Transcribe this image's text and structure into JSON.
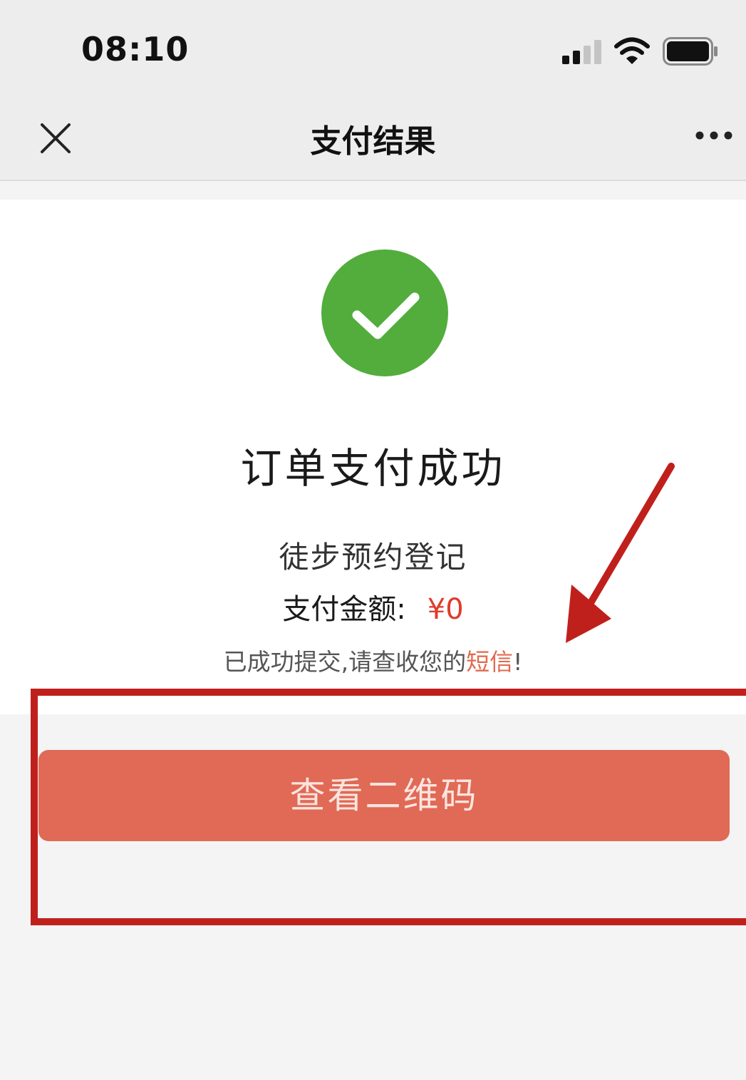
{
  "status_bar": {
    "time": "08:10",
    "icons": [
      "cellular-signal-icon",
      "wifi-icon",
      "battery-icon"
    ]
  },
  "nav": {
    "title": "支付结果",
    "close_icon": "close-icon",
    "more_icon": "more-icon"
  },
  "result": {
    "icon": "checkmark-circle-icon",
    "title": "订单支付成功",
    "order_name": "徒步预约登记",
    "amount_label": "支付金额:",
    "amount_value": "¥0",
    "notice_text": "已成功提交,请查收您的",
    "notice_link": "短信",
    "notice_end": "!"
  },
  "actions": {
    "qr_button_label": "查看二维码"
  },
  "colors": {
    "success_green": "#52ad3c",
    "accent_red": "#e03b2b",
    "button_fill": "#e06a55",
    "annotation_red": "#c0201c"
  },
  "annotations": [
    "highlight-box",
    "pointer-arrow"
  ]
}
